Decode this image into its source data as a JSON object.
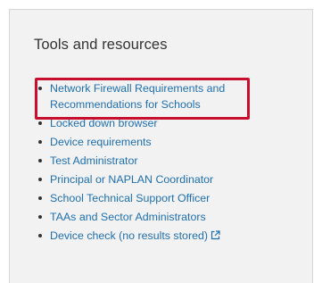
{
  "panel": {
    "title": "Tools and resources",
    "items": [
      {
        "label": "Network Firewall Requirements and Recommendations for Schools",
        "highlighted": true
      },
      {
        "label": "Locked down browser"
      },
      {
        "label": "Device requirements"
      },
      {
        "label": "Test Administrator"
      },
      {
        "label": "Principal or NAPLAN Coordinator"
      },
      {
        "label": "School Technical Support Officer"
      },
      {
        "label": "TAAs and Sector Administrators"
      },
      {
        "label": "Device check (no results stored)",
        "icon": "external-link-icon"
      }
    ]
  },
  "colors": {
    "panel_bg": "#f2f2f2",
    "link": "#1f6fae",
    "title": "#333333",
    "highlight": "#c8102e"
  }
}
